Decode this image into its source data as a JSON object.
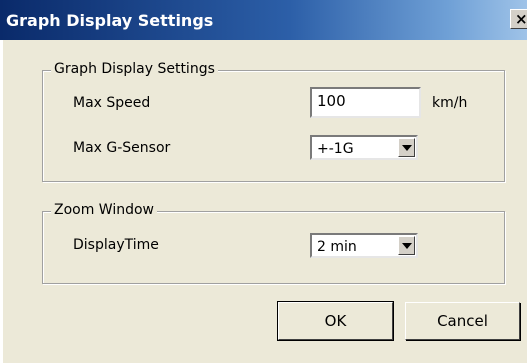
{
  "window": {
    "title": "Graph Display Settings",
    "close_glyph": "×"
  },
  "group_graph": {
    "legend": "Graph Display Settings",
    "max_speed_label": "Max Speed",
    "max_speed_value": "100",
    "max_speed_unit": "km/h",
    "max_gsensor_label": "Max G-Sensor",
    "max_gsensor_value": "+-1G"
  },
  "group_zoom": {
    "legend": "Zoom Window",
    "display_time_label": "DisplayTime",
    "display_time_value": "2 min"
  },
  "buttons": {
    "ok": "OK",
    "cancel": "Cancel"
  },
  "icons": {
    "close": "close-icon",
    "dropdown": "chevron-down-icon"
  },
  "colors": {
    "title_bar_start": "#0a2a6a",
    "title_bar_end": "#9fc3e8",
    "dialog_bg": "#ece9d8"
  }
}
